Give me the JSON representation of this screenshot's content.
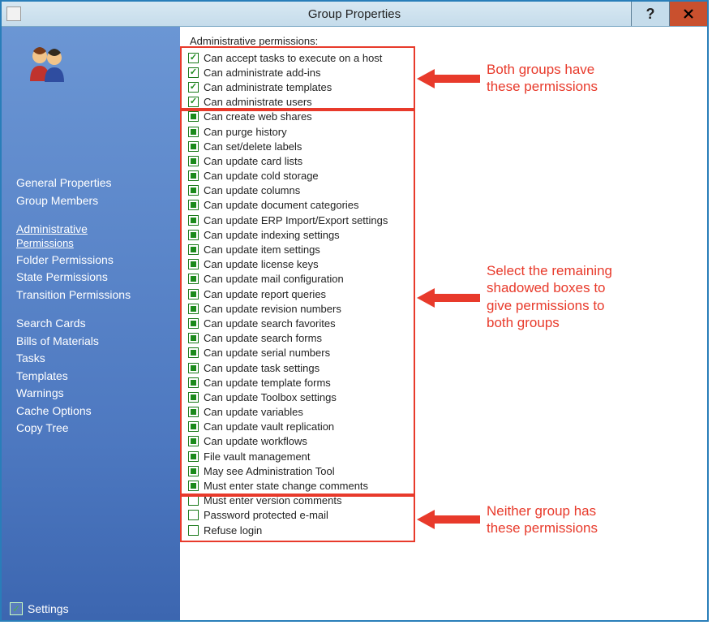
{
  "window": {
    "title": "Group Properties"
  },
  "sidebar": {
    "items": [
      {
        "label": "General Properties",
        "active": false
      },
      {
        "label": "Group Members",
        "active": false
      },
      {
        "spacer": true
      },
      {
        "label": "Administrative",
        "sub": "Permissions",
        "active": true
      },
      {
        "label": "Folder Permissions",
        "active": false
      },
      {
        "label": "State Permissions",
        "active": false
      },
      {
        "label": "Transition Permissions",
        "active": false
      },
      {
        "spacer": true
      },
      {
        "label": "Search Cards",
        "active": false
      },
      {
        "label": "Bills of Materials",
        "active": false
      },
      {
        "label": "Tasks",
        "active": false
      },
      {
        "label": "Templates",
        "active": false
      },
      {
        "label": "Warnings",
        "active": false
      },
      {
        "label": "Cache Options",
        "active": false
      },
      {
        "label": "Copy Tree",
        "active": false
      }
    ],
    "settings_label": "Settings"
  },
  "content": {
    "heading": "Administrative permissions:",
    "permissions": [
      {
        "label": "Can accept tasks to execute on a host",
        "state": "checked"
      },
      {
        "label": "Can administrate add-ins",
        "state": "checked"
      },
      {
        "label": "Can administrate templates",
        "state": "checked"
      },
      {
        "label": "Can administrate users",
        "state": "checked"
      },
      {
        "label": "Can create web shares",
        "state": "indet"
      },
      {
        "label": "Can purge history",
        "state": "indet"
      },
      {
        "label": "Can set/delete labels",
        "state": "indet"
      },
      {
        "label": "Can update card lists",
        "state": "indet"
      },
      {
        "label": "Can update cold storage",
        "state": "indet"
      },
      {
        "label": "Can update columns",
        "state": "indet"
      },
      {
        "label": "Can update document categories",
        "state": "indet"
      },
      {
        "label": "Can update ERP Import/Export settings",
        "state": "indet"
      },
      {
        "label": "Can update indexing settings",
        "state": "indet"
      },
      {
        "label": "Can update item settings",
        "state": "indet"
      },
      {
        "label": "Can update license keys",
        "state": "indet"
      },
      {
        "label": "Can update mail configuration",
        "state": "indet"
      },
      {
        "label": "Can update report queries",
        "state": "indet"
      },
      {
        "label": "Can update revision numbers",
        "state": "indet"
      },
      {
        "label": "Can update search favorites",
        "state": "indet"
      },
      {
        "label": "Can update search forms",
        "state": "indet"
      },
      {
        "label": "Can update serial numbers",
        "state": "indet"
      },
      {
        "label": "Can update task settings",
        "state": "indet"
      },
      {
        "label": "Can update template forms",
        "state": "indet"
      },
      {
        "label": "Can update Toolbox settings",
        "state": "indet"
      },
      {
        "label": "Can update variables",
        "state": "indet"
      },
      {
        "label": "Can update vault replication",
        "state": "indet"
      },
      {
        "label": "Can update workflows",
        "state": "indet"
      },
      {
        "label": "File vault management",
        "state": "indet"
      },
      {
        "label": "May see Administration Tool",
        "state": "indet"
      },
      {
        "label": "Must enter state change comments",
        "state": "indet"
      },
      {
        "label": "Must enter version comments",
        "state": "empty"
      },
      {
        "label": "Password protected e-mail",
        "state": "empty"
      },
      {
        "label": "Refuse login",
        "state": "empty"
      }
    ]
  },
  "annotations": {
    "top": "Both groups have\nthese permissions",
    "middle": "Select the remaining\nshadowed boxes to\ngive permissions to\nboth groups",
    "bottom": "Neither group has\nthese permissions"
  }
}
